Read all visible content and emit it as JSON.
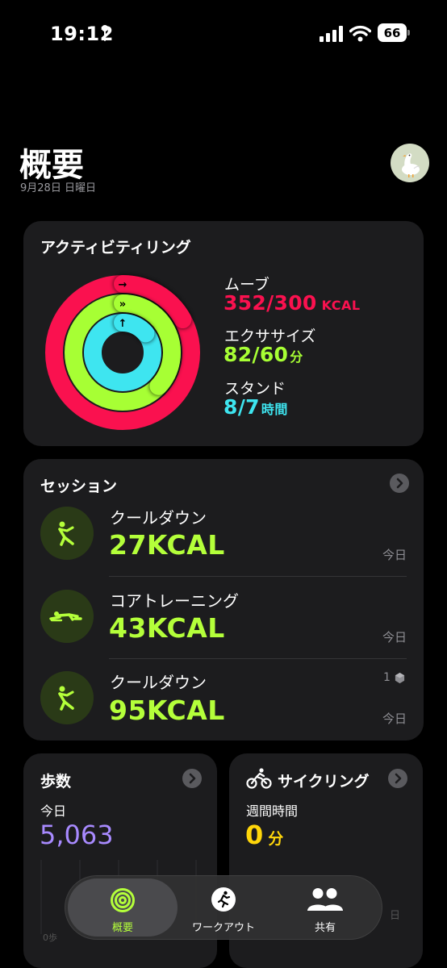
{
  "status_bar": {
    "time": "19:12",
    "battery": "66"
  },
  "header": {
    "title": "概要",
    "date": "9月28日 日曜日"
  },
  "activity": {
    "title": "アクティビティリング",
    "move": {
      "label": "ムーブ",
      "value": "352/300",
      "unit": "KCAL",
      "progress": 1.17,
      "color": "#fa114f"
    },
    "exercise": {
      "label": "エクササイズ",
      "value": "82/60",
      "unit": "分",
      "progress": 1.37,
      "color": "#a7ff34"
    },
    "stand": {
      "label": "スタンド",
      "value": "8/7",
      "unit": "時間",
      "progress": 1.14,
      "color": "#3ee5f0"
    }
  },
  "sessions": {
    "title": "セッション",
    "items": [
      {
        "name": "クールダウン",
        "kcal": "27KCAL",
        "when": "今日",
        "icon": "cooldown-icon"
      },
      {
        "name": "コアトレーニング",
        "kcal": "43KCAL",
        "when": "今日",
        "icon": "core-training-icon"
      },
      {
        "name": "クールダウン",
        "kcal": "95KCAL",
        "when": "今日",
        "icon": "cooldown-icon",
        "badge": "1"
      }
    ]
  },
  "steps": {
    "title": "歩数",
    "label": "今日",
    "value": "5,063",
    "axis_zero": "0歩"
  },
  "cycling": {
    "title": "サイクリング",
    "label": "週間時間",
    "value": "0",
    "unit": "分",
    "axis_day": "日"
  },
  "tabs": [
    {
      "label": "概要",
      "icon": "summary-rings-icon",
      "active": true
    },
    {
      "label": "ワークアウト",
      "icon": "workout-runner-icon",
      "active": false
    },
    {
      "label": "共有",
      "icon": "sharing-people-icon",
      "active": false
    }
  ]
}
